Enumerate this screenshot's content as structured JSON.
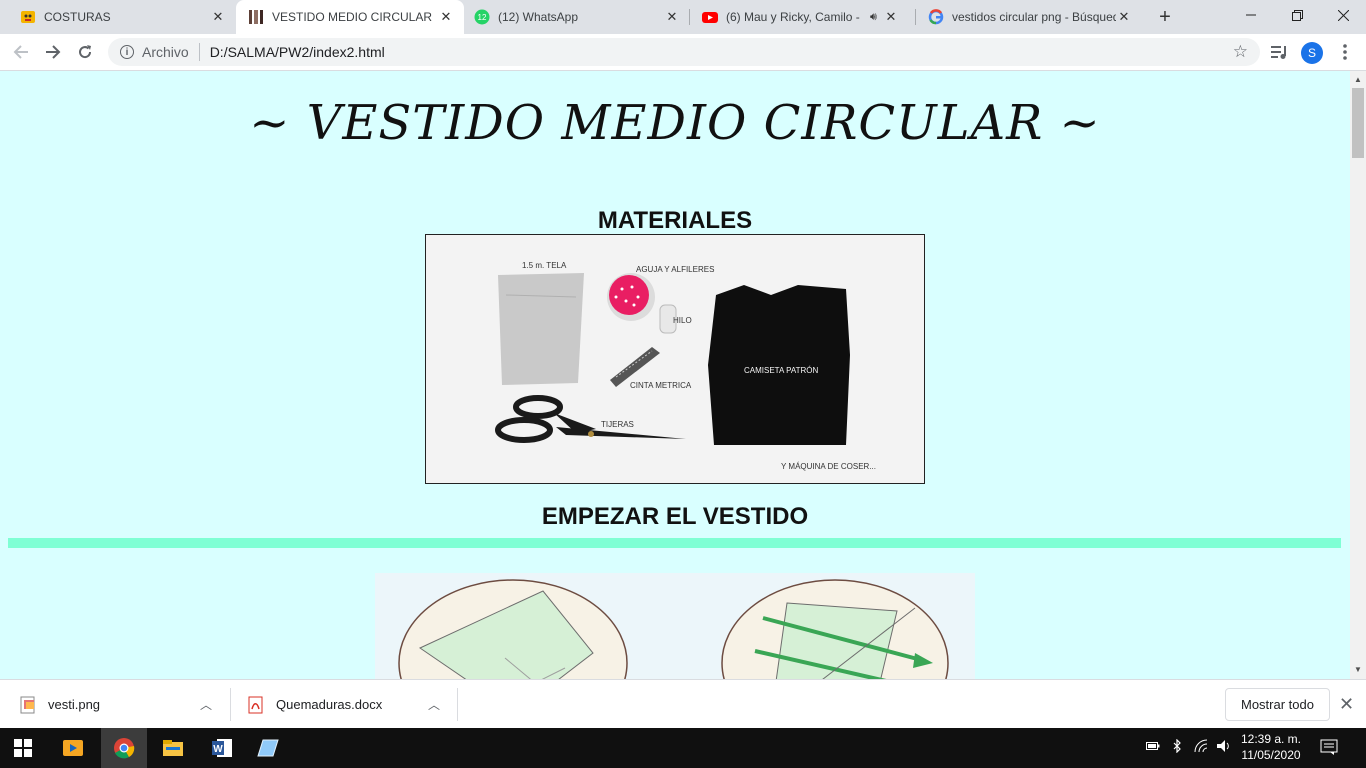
{
  "tabs": [
    {
      "label": "COSTURAS",
      "icon": "lemon-emoji-icon",
      "active": false
    },
    {
      "label": "VESTIDO MEDIO CIRCULAR",
      "icon": "dress-icon",
      "active": true
    },
    {
      "label": "(12) WhatsApp",
      "icon": "whatsapp-icon",
      "badge": "12",
      "active": false
    },
    {
      "label": "(6) Mau y Ricky, Camilo - L",
      "icon": "youtube-icon",
      "audio": true,
      "active": false
    },
    {
      "label": "vestidos circular png - Búsqued",
      "icon": "google-icon",
      "active": false
    }
  ],
  "address": {
    "chip": "Archivo",
    "url": "D:/SALMA/PW2/index2.html"
  },
  "profile_initial": "S",
  "page": {
    "title": "~ VESTIDO MEDIO CIRCULAR ~",
    "materials_heading": "MATERIALES",
    "start_heading": "EMPEZAR EL VESTIDO",
    "materials_image": {
      "labels": {
        "tela": "1.5 m. TELA",
        "aguja": "AGUJA Y ALFILERES",
        "hilo": "HILO",
        "cinta": "CINTA METRICA",
        "tijeras": "TIJERAS",
        "camiseta": "CAMISETA PATRÓN",
        "maquina": "Y MÁQUINA DE COSER..."
      }
    },
    "colors": {
      "background": "#d9ffff",
      "divider": "#7fffd4"
    }
  },
  "downloads": [
    {
      "name": "vesti.png",
      "icon": "image-file-icon"
    },
    {
      "name": "Quemaduras.docx",
      "icon": "pdf-file-icon"
    }
  ],
  "downloads_show_all": "Mostrar todo",
  "taskbar": {
    "time": "12:39 a. m.",
    "date": "11/05/2020"
  }
}
